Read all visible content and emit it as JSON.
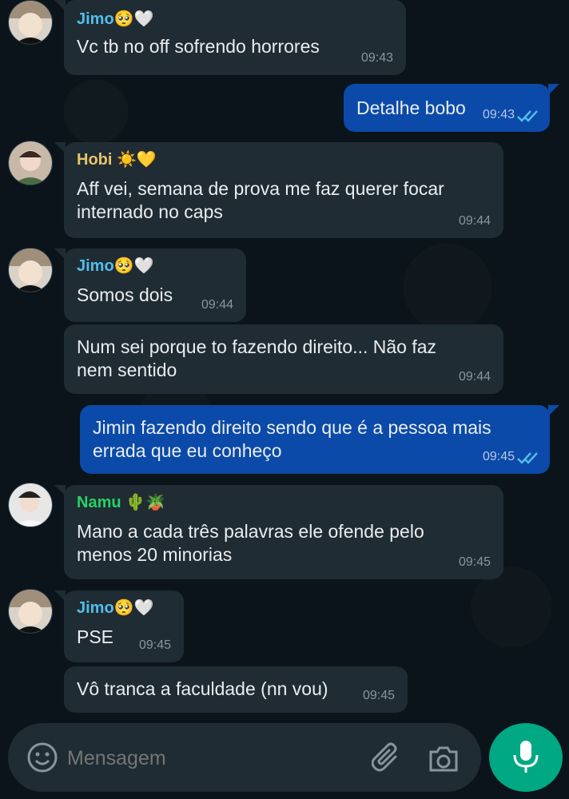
{
  "colors": {
    "jimo": "#53bdeb",
    "hobi": "#e9c46a",
    "namu": "#25d366",
    "incoming_bubble": "#202c33",
    "outgoing_bubble": "#0b4aa8",
    "mic_button": "#00a884"
  },
  "messages": [
    {
      "sender": "Jimo🥺🤍",
      "text": "Vc tb no off sofrendo horrores",
      "time": "09:43"
    },
    {
      "text": "Detalhe bobo",
      "time": "09:43"
    },
    {
      "sender": "Hobi ☀️💛",
      "text": "Aff vei, semana de prova me faz querer focar internado no caps",
      "time": "09:44"
    },
    {
      "sender": "Jimo🥺🤍",
      "text": "Somos dois",
      "time": "09:44"
    },
    {
      "text": "Num sei porque to fazendo direito... Não faz nem sentido",
      "time": "09:44"
    },
    {
      "text": "Jimin fazendo direito sendo que é a pessoa mais errada que eu conheço",
      "time": "09:45"
    },
    {
      "sender": "Namu 🌵🪴",
      "text": "Mano a cada três palavras ele ofende pelo menos 20 minorias",
      "time": "09:45"
    },
    {
      "sender": "Jimo🥺🤍",
      "text": "PSE",
      "time": "09:45"
    },
    {
      "text": "Vô tranca a faculdade (nn vou)",
      "time": "09:45"
    }
  ],
  "input": {
    "placeholder": "Mensagem",
    "emoji_icon": "emoji-icon",
    "attach_icon": "paperclip-icon",
    "camera_icon": "camera-icon",
    "mic_icon": "microphone-icon"
  }
}
